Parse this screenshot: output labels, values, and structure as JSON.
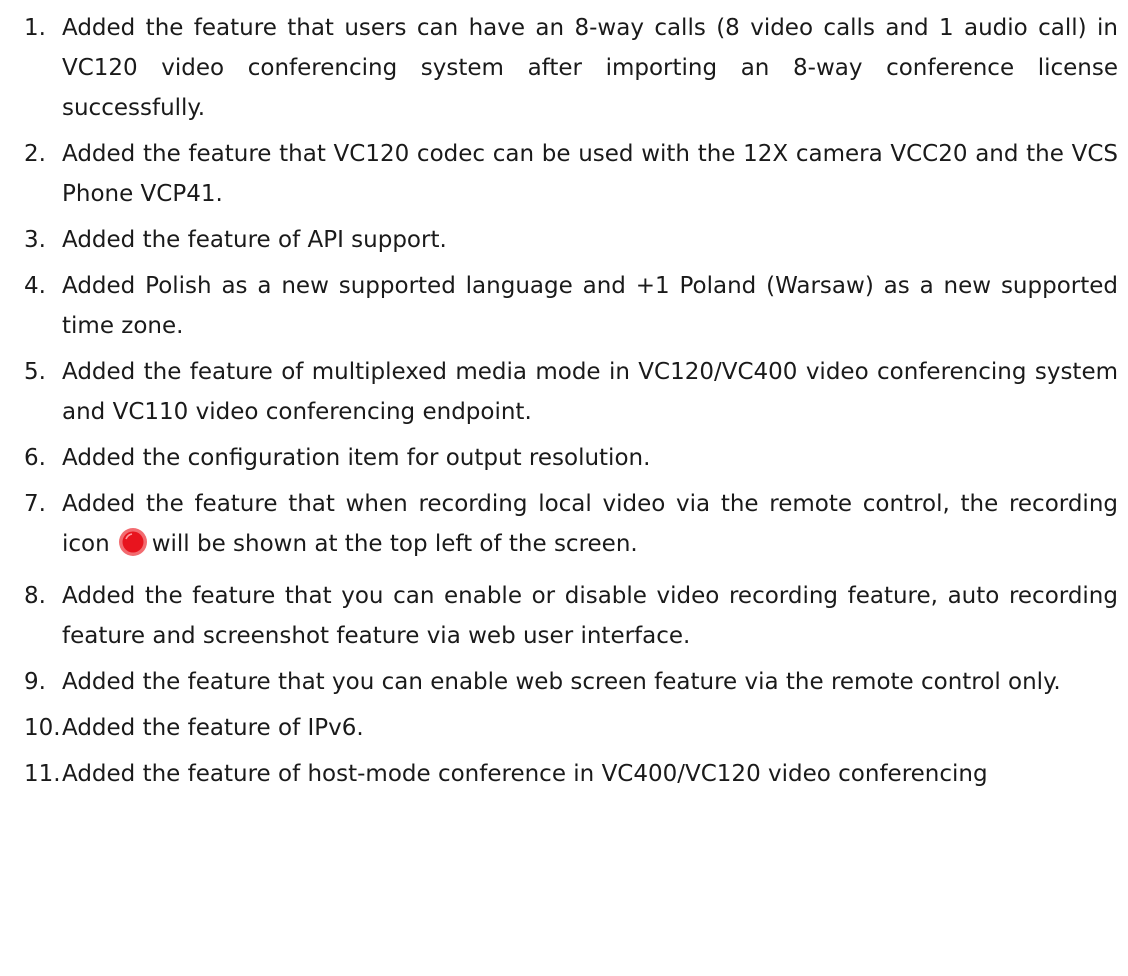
{
  "features": [
    {
      "num": "1.",
      "text": "Added the feature that users can have an 8-way calls (8 video calls and 1 audio call) in VC120 video conferencing system after importing an 8-way conference license successfully."
    },
    {
      "num": "2.",
      "text": "Added the feature that VC120 codec can be used with the 12X camera VCC20 and the VCS Phone VCP41."
    },
    {
      "num": "3.",
      "text": "Added the feature of API support."
    },
    {
      "num": "4.",
      "text": "Added Polish as a new supported language and +1 Poland (Warsaw) as a new supported time zone."
    },
    {
      "num": "5.",
      "text": "Added the feature of multiplexed media mode in VC120/VC400 video conferencing system and VC110 video conferencing endpoint."
    },
    {
      "num": "6.",
      "text": "Added the configuration item for output resolution."
    },
    {
      "num": "7.",
      "text_before_icon": "Added the feature that when recording local video via the remote control, the recording icon",
      "text_after_icon": "will be shown at the top left of the screen.",
      "icon": "recording-icon"
    },
    {
      "num": "8.",
      "text": "Added the feature that you can enable or disable video recording feature, auto recording feature and screenshot feature via web user interface."
    },
    {
      "num": "9.",
      "text": "Added the feature that you can enable web screen feature via the remote control only."
    },
    {
      "num": "10.",
      "text": "Added the feature of IPv6."
    },
    {
      "num": "11.",
      "text": "Added the feature of host-mode conference in VC400/VC120 video conferencing"
    }
  ],
  "colors": {
    "text": "#1a1a1a",
    "recording_icon": "#e8141e"
  }
}
